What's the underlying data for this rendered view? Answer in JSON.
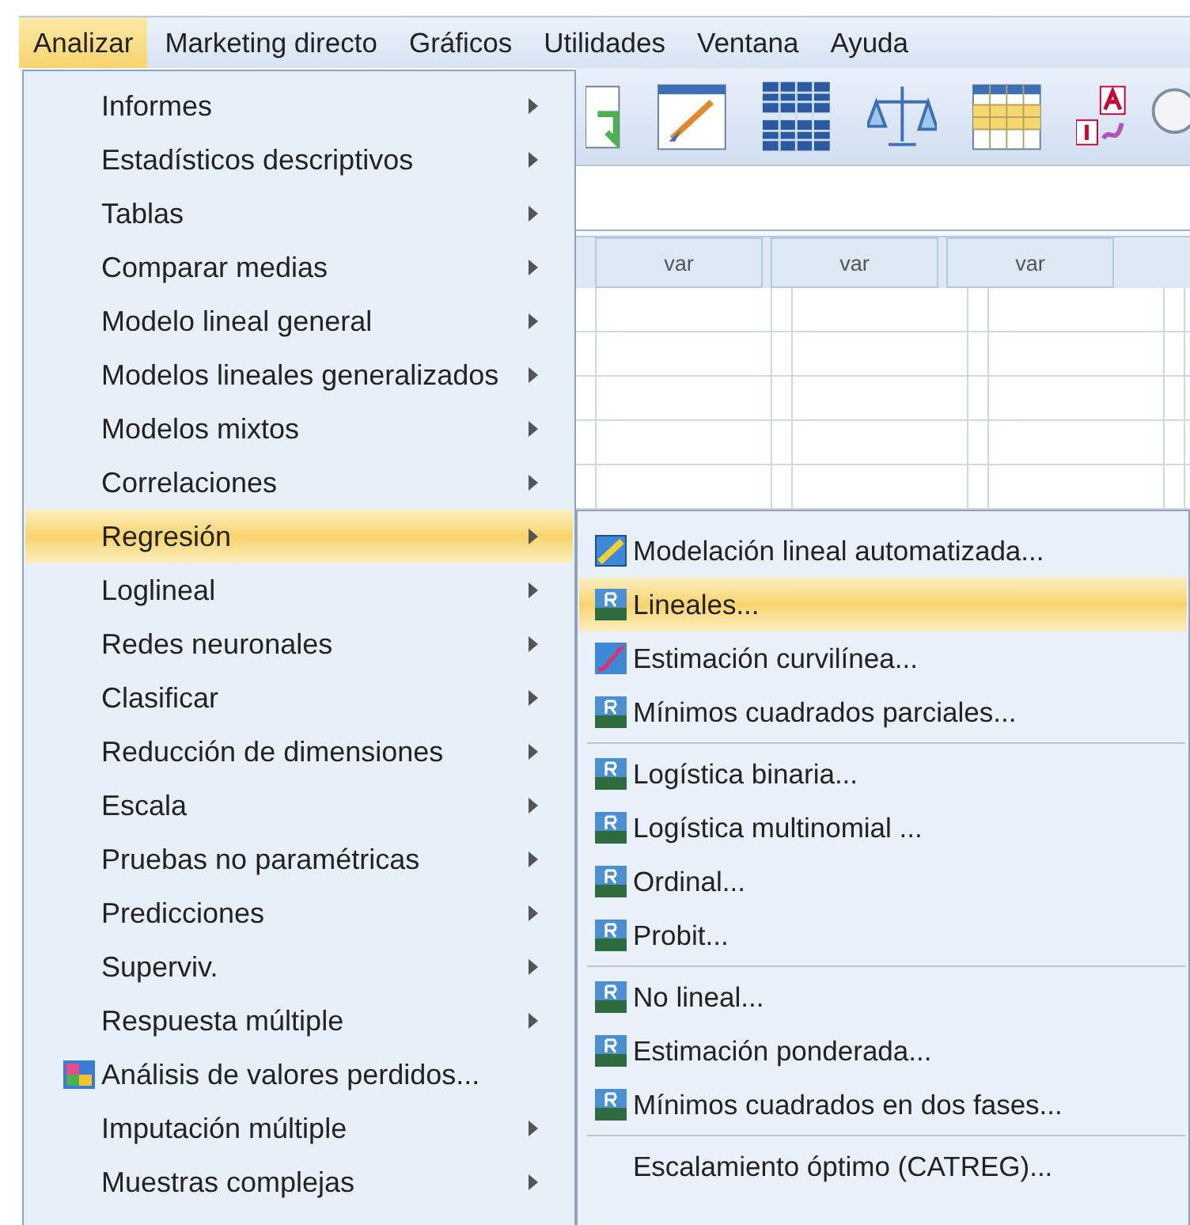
{
  "menubar": [
    {
      "label": "Analizar",
      "selected": true
    },
    {
      "label": "Marketing directo",
      "selected": false
    },
    {
      "label": "Gráficos",
      "selected": false
    },
    {
      "label": "Utilidades",
      "selected": false
    },
    {
      "label": "Ventana",
      "selected": false
    },
    {
      "label": "Ayuda",
      "selected": false
    }
  ],
  "grid": {
    "columns": [
      "var",
      "var",
      "var"
    ]
  },
  "menu": {
    "items": [
      {
        "label": "Informes",
        "submenu": true,
        "selected": false,
        "icon": false
      },
      {
        "label": "Estadísticos descriptivos",
        "submenu": true,
        "selected": false,
        "icon": false
      },
      {
        "label": "Tablas",
        "submenu": true,
        "selected": false,
        "icon": false
      },
      {
        "label": "Comparar medias",
        "submenu": true,
        "selected": false,
        "icon": false
      },
      {
        "label": "Modelo lineal general",
        "submenu": true,
        "selected": false,
        "icon": false
      },
      {
        "label": "Modelos lineales generalizados",
        "submenu": true,
        "selected": false,
        "icon": false
      },
      {
        "label": "Modelos mixtos",
        "submenu": true,
        "selected": false,
        "icon": false
      },
      {
        "label": "Correlaciones",
        "submenu": true,
        "selected": false,
        "icon": false
      },
      {
        "label": "Regresión",
        "submenu": true,
        "selected": true,
        "icon": false
      },
      {
        "label": "Loglineal",
        "submenu": true,
        "selected": false,
        "icon": false
      },
      {
        "label": "Redes neuronales",
        "submenu": true,
        "selected": false,
        "icon": false
      },
      {
        "label": "Clasificar",
        "submenu": true,
        "selected": false,
        "icon": false
      },
      {
        "label": "Reducción de dimensiones",
        "submenu": true,
        "selected": false,
        "icon": false
      },
      {
        "label": "Escala",
        "submenu": true,
        "selected": false,
        "icon": false
      },
      {
        "label": "Pruebas no paramétricas",
        "submenu": true,
        "selected": false,
        "icon": false
      },
      {
        "label": "Predicciones",
        "submenu": true,
        "selected": false,
        "icon": false
      },
      {
        "label": "Superviv.",
        "submenu": true,
        "selected": false,
        "icon": false
      },
      {
        "label": "Respuesta múltiple",
        "submenu": true,
        "selected": false,
        "icon": false
      },
      {
        "label": "Análisis de valores perdidos...",
        "submenu": false,
        "selected": false,
        "icon": true
      },
      {
        "label": "Imputación múltiple",
        "submenu": true,
        "selected": false,
        "icon": false
      },
      {
        "label": "Muestras complejas",
        "submenu": true,
        "selected": false,
        "icon": false
      }
    ]
  },
  "submenu": {
    "items": [
      {
        "label": "Modelación lineal automatizada...",
        "kind": "chart",
        "selected": false,
        "separator_before": false
      },
      {
        "label": "Lineales...",
        "kind": "badge",
        "selected": true,
        "separator_before": false
      },
      {
        "label": "Estimación curvilínea...",
        "kind": "curve",
        "selected": false,
        "separator_before": false
      },
      {
        "label": "Mínimos cuadrados parciales...",
        "kind": "badge",
        "selected": false,
        "separator_before": false
      },
      {
        "label": "Logística binaria...",
        "kind": "badge",
        "selected": false,
        "separator_before": true
      },
      {
        "label": "Logística multinomial ...",
        "kind": "badge",
        "selected": false,
        "separator_before": false
      },
      {
        "label": "Ordinal...",
        "kind": "badge",
        "selected": false,
        "separator_before": false
      },
      {
        "label": "Probit...",
        "kind": "badge",
        "selected": false,
        "separator_before": false
      },
      {
        "label": "No lineal...",
        "kind": "badge",
        "selected": false,
        "separator_before": true
      },
      {
        "label": "Estimación ponderada...",
        "kind": "badge",
        "selected": false,
        "separator_before": false
      },
      {
        "label": "Mínimos cuadrados en dos fases...",
        "kind": "badge",
        "selected": false,
        "separator_before": false
      },
      {
        "label": "Escalamiento óptimo (CATREG)...",
        "kind": "plain",
        "selected": false,
        "separator_before": true
      }
    ]
  }
}
